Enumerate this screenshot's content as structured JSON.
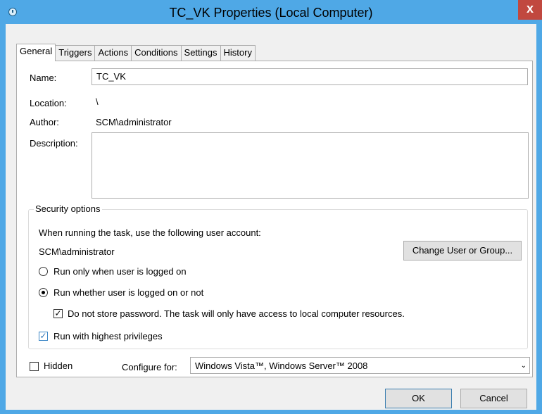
{
  "window": {
    "title": "TC_VK Properties (Local Computer)",
    "close_glyph": "x"
  },
  "tabs": [
    "General",
    "Triggers",
    "Actions",
    "Conditions",
    "Settings",
    "History"
  ],
  "general": {
    "name_label": "Name:",
    "name_value": "TC_VK",
    "location_label": "Location:",
    "location_value": "\\",
    "author_label": "Author:",
    "author_value": "SCM\\administrator",
    "description_label": "Description:"
  },
  "security": {
    "title": "Security options",
    "account_prompt": "When running the task, use the following user account:",
    "account_value": "SCM\\administrator",
    "change_button": "Change User or Group...",
    "radio_logged_on": "Run only when user is logged on",
    "radio_whether": "Run whether user is logged on or not",
    "do_not_store": "Do not store password.  The task will only have access to local computer resources.",
    "highest_privileges": "Run with highest privileges"
  },
  "bottom": {
    "hidden_label": "Hidden",
    "configure_label": "Configure for:",
    "configure_value": "Windows Vista™, Windows Server™ 2008",
    "ok_button": "OK",
    "cancel_button": "Cancel"
  }
}
